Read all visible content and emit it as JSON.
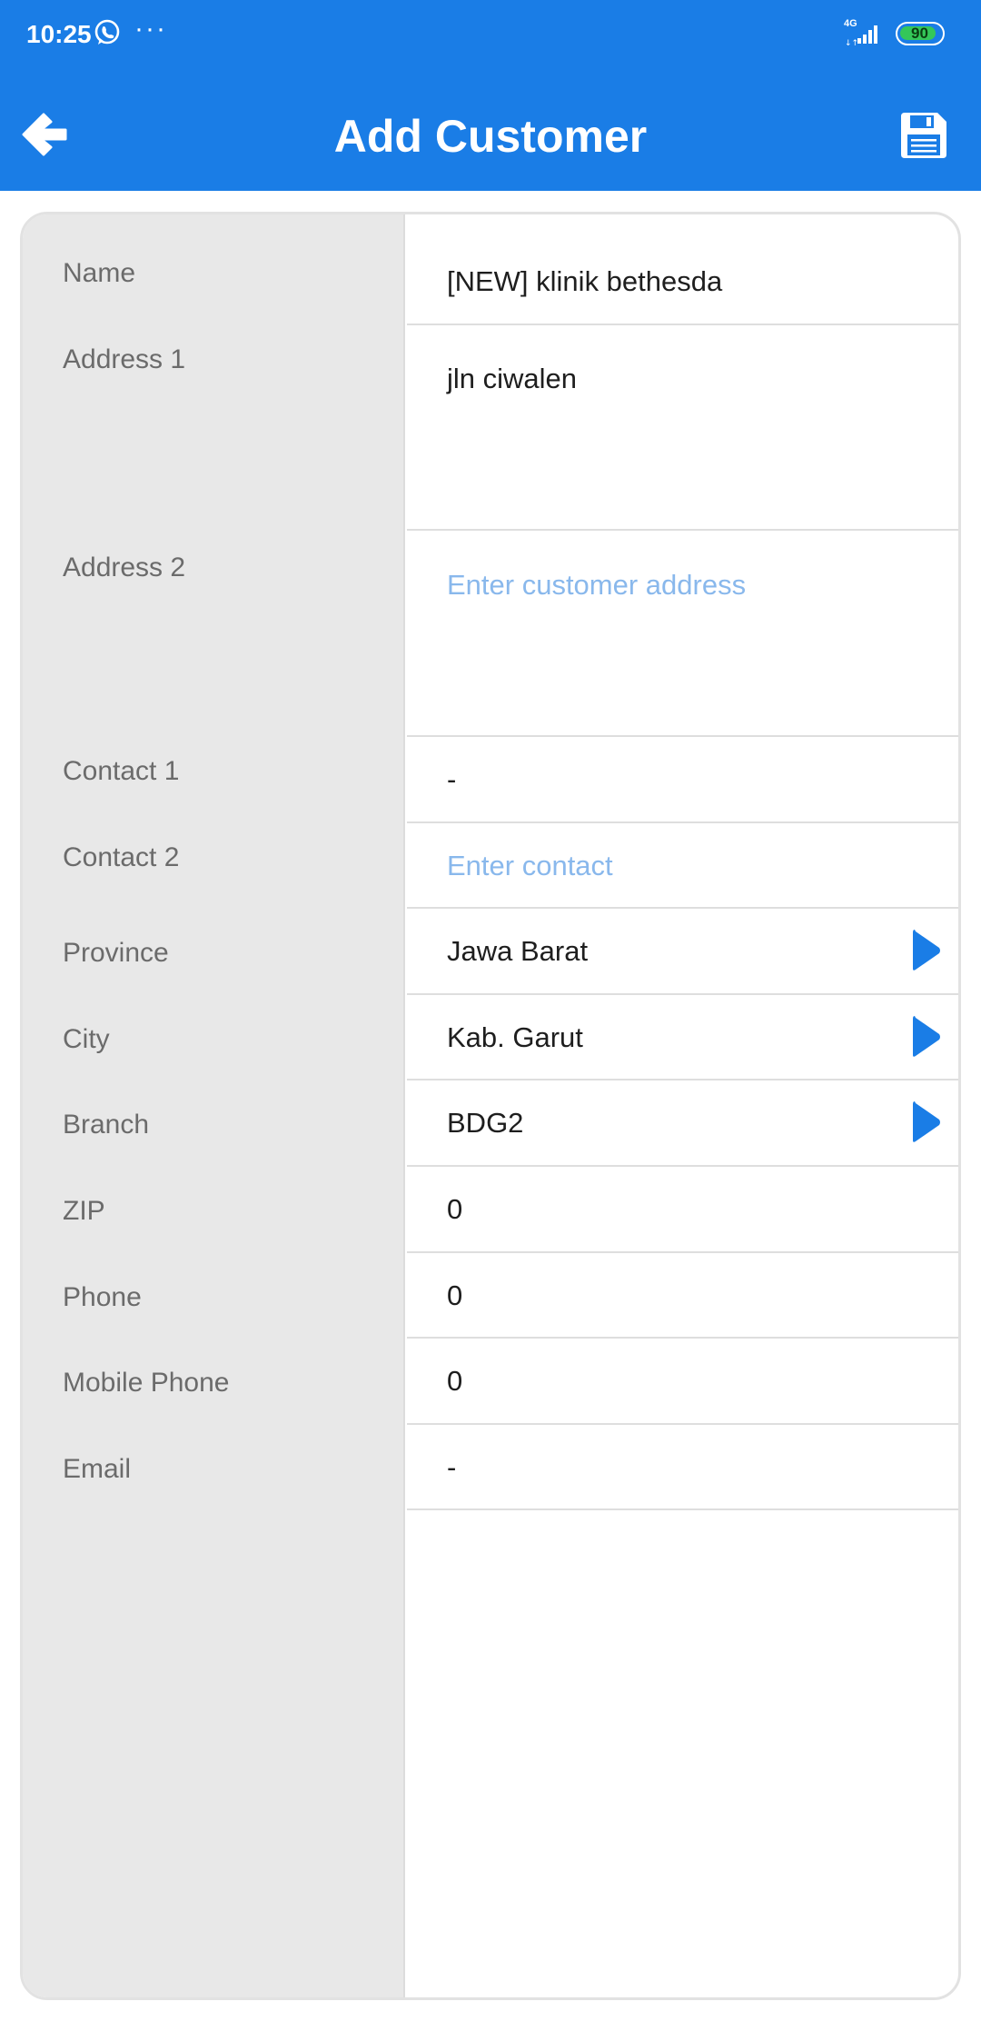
{
  "status_bar": {
    "time": "10:25",
    "network": "4G",
    "battery": "90",
    "battery_level_percent": 90
  },
  "app_bar": {
    "title": "Add Customer",
    "back_icon": "arrow-left-icon",
    "save_icon": "floppy-disk-icon"
  },
  "colors": {
    "accent": "#1a7de6",
    "placeholder": "#89b8ec",
    "label": "#6b6b6b",
    "label_column_bg": "#e8e8e8"
  },
  "form": {
    "name": {
      "label": "Name",
      "value": "[NEW] klinik bethesda"
    },
    "address1": {
      "label": "Address 1",
      "value": "jln ciwalen"
    },
    "address2": {
      "label": "Address 2",
      "placeholder": "Enter customer address"
    },
    "contact1": {
      "label": "Contact 1",
      "value": "-"
    },
    "contact2": {
      "label": "Contact 2",
      "placeholder": "Enter contact"
    },
    "province": {
      "label": "Province",
      "value": "Jawa Barat"
    },
    "city": {
      "label": "City",
      "value": "Kab. Garut"
    },
    "branch": {
      "label": "Branch",
      "value": "BDG2"
    },
    "zip": {
      "label": "ZIP",
      "value": "0"
    },
    "phone": {
      "label": "Phone",
      "value": "0"
    },
    "mobile_phone": {
      "label": "Mobile Phone",
      "value": "0"
    },
    "email": {
      "label": "Email",
      "value": "-"
    }
  }
}
